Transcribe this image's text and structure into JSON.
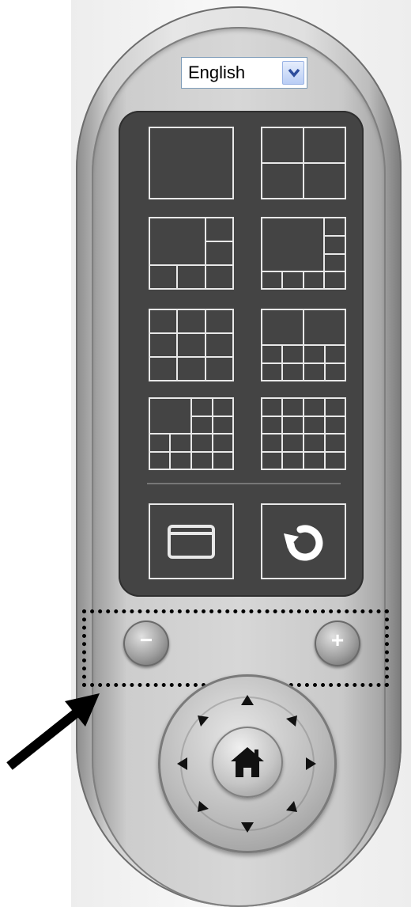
{
  "language_selector": {
    "selected": "English",
    "dropdown_icon": "chevron-down-icon"
  },
  "layouts": [
    {
      "name": "layout-1-view"
    },
    {
      "name": "layout-4-view"
    },
    {
      "name": "layout-6-view"
    },
    {
      "name": "layout-8-view"
    },
    {
      "name": "layout-9-view"
    },
    {
      "name": "layout-10-view"
    },
    {
      "name": "layout-13-view"
    },
    {
      "name": "layout-16-view"
    }
  ],
  "actions": {
    "fullscreen_icon": "window-icon",
    "refresh_icon": "refresh-icon"
  },
  "zoom": {
    "out_label": "−",
    "in_label": "+"
  },
  "ptz": {
    "home_icon": "home-icon",
    "directions": [
      "up",
      "up-right",
      "right",
      "down-right",
      "down",
      "down-left",
      "left",
      "up-left"
    ]
  },
  "colors": {
    "panel": "#444444",
    "button_outline": "#e8e8e8",
    "highlight": "#000000"
  }
}
